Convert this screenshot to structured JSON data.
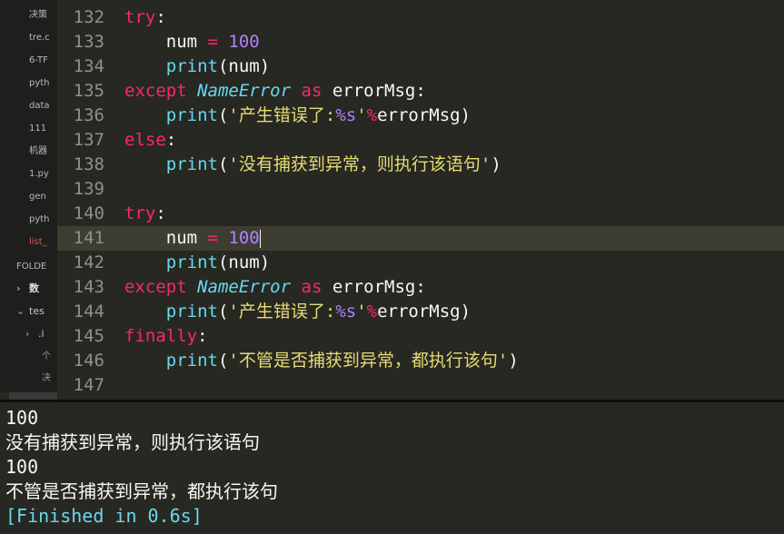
{
  "sidebar": {
    "open_files": [
      "决策",
      "tre.c",
      "6-TF",
      "pyth",
      "data",
      "111",
      "机器",
      "1.py",
      "gen",
      "pyth",
      "list_"
    ],
    "folders_label": "FOLDE",
    "tree": {
      "folder1": "数",
      "folder2": "tes",
      "sub": ".i",
      "extra1": "个",
      "extra2": "决"
    }
  },
  "editor": {
    "lines": [
      {
        "n": "132",
        "tokens": [
          [
            "kw",
            "try"
          ],
          [
            "plain",
            ":"
          ]
        ]
      },
      {
        "n": "133",
        "tokens": [
          [
            "plain",
            "    num "
          ],
          [
            "op",
            "="
          ],
          [
            "plain",
            " "
          ],
          [
            "num",
            "100"
          ]
        ]
      },
      {
        "n": "134",
        "tokens": [
          [
            "plain",
            "    "
          ],
          [
            "fn",
            "print"
          ],
          [
            "plain",
            "(num)"
          ]
        ]
      },
      {
        "n": "135",
        "tokens": [
          [
            "kw",
            "except"
          ],
          [
            "plain",
            " "
          ],
          [
            "cls",
            "NameError"
          ],
          [
            "plain",
            " "
          ],
          [
            "kw",
            "as"
          ],
          [
            "plain",
            " errorMsg:"
          ]
        ]
      },
      {
        "n": "136",
        "tokens": [
          [
            "plain",
            "    "
          ],
          [
            "fn",
            "print"
          ],
          [
            "plain",
            "("
          ],
          [
            "str",
            "'产生错误了:"
          ],
          [
            "fmt",
            "%s"
          ],
          [
            "str",
            "'"
          ],
          [
            "op",
            "%"
          ],
          [
            "plain",
            "errorMsg)"
          ]
        ]
      },
      {
        "n": "137",
        "tokens": [
          [
            "kw",
            "else"
          ],
          [
            "plain",
            ":"
          ]
        ]
      },
      {
        "n": "138",
        "tokens": [
          [
            "plain",
            "    "
          ],
          [
            "fn",
            "print"
          ],
          [
            "plain",
            "("
          ],
          [
            "str",
            "'没有捕获到异常，则执行该语句'"
          ],
          [
            "plain",
            ")"
          ]
        ]
      },
      {
        "n": "139",
        "tokens": []
      },
      {
        "n": "140",
        "tokens": [
          [
            "kw",
            "try"
          ],
          [
            "plain",
            ":"
          ]
        ]
      },
      {
        "n": "141",
        "current": true,
        "tokens": [
          [
            "plain",
            "    num "
          ],
          [
            "op",
            "="
          ],
          [
            "plain",
            " "
          ],
          [
            "num",
            "100"
          ],
          [
            "cursor",
            ""
          ]
        ]
      },
      {
        "n": "142",
        "tokens": [
          [
            "plain",
            "    "
          ],
          [
            "fn",
            "print"
          ],
          [
            "plain",
            "(num)"
          ]
        ]
      },
      {
        "n": "143",
        "tokens": [
          [
            "kw",
            "except"
          ],
          [
            "plain",
            " "
          ],
          [
            "cls",
            "NameError"
          ],
          [
            "plain",
            " "
          ],
          [
            "kw",
            "as"
          ],
          [
            "plain",
            " errorMsg:"
          ]
        ]
      },
      {
        "n": "144",
        "tokens": [
          [
            "plain",
            "    "
          ],
          [
            "fn",
            "print"
          ],
          [
            "plain",
            "("
          ],
          [
            "str",
            "'产生错误了:"
          ],
          [
            "fmt",
            "%s"
          ],
          [
            "str",
            "'"
          ],
          [
            "op",
            "%"
          ],
          [
            "plain",
            "errorMsg)"
          ]
        ]
      },
      {
        "n": "145",
        "tokens": [
          [
            "kw",
            "finally"
          ],
          [
            "plain",
            ":"
          ]
        ]
      },
      {
        "n": "146",
        "tokens": [
          [
            "plain",
            "    "
          ],
          [
            "fn",
            "print"
          ],
          [
            "plain",
            "("
          ],
          [
            "str",
            "'不管是否捕获到异常，都执行该句'"
          ],
          [
            "plain",
            ")"
          ]
        ]
      },
      {
        "n": "147",
        "tokens": []
      }
    ]
  },
  "output": {
    "lines": [
      "100",
      "没有捕获到异常，则执行该语句",
      "100",
      "不管是否捕获到异常，都执行该句"
    ],
    "finished": "[Finished in 0.6s]"
  }
}
